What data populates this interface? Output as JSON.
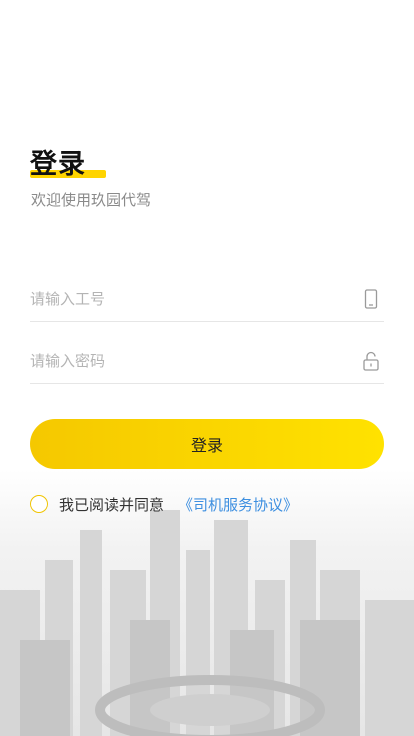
{
  "header": {
    "title": "登录",
    "subtitle": "欢迎使用玖园代驾"
  },
  "form": {
    "employee_id_placeholder": "请输入工号",
    "password_placeholder": "请输入密码"
  },
  "login_button_label": "登录",
  "agreement": {
    "text": "我已阅读并同意",
    "link": "《司机服务协议》"
  },
  "colors": {
    "accent": "#ffd400",
    "link": "#3d8fe0"
  }
}
